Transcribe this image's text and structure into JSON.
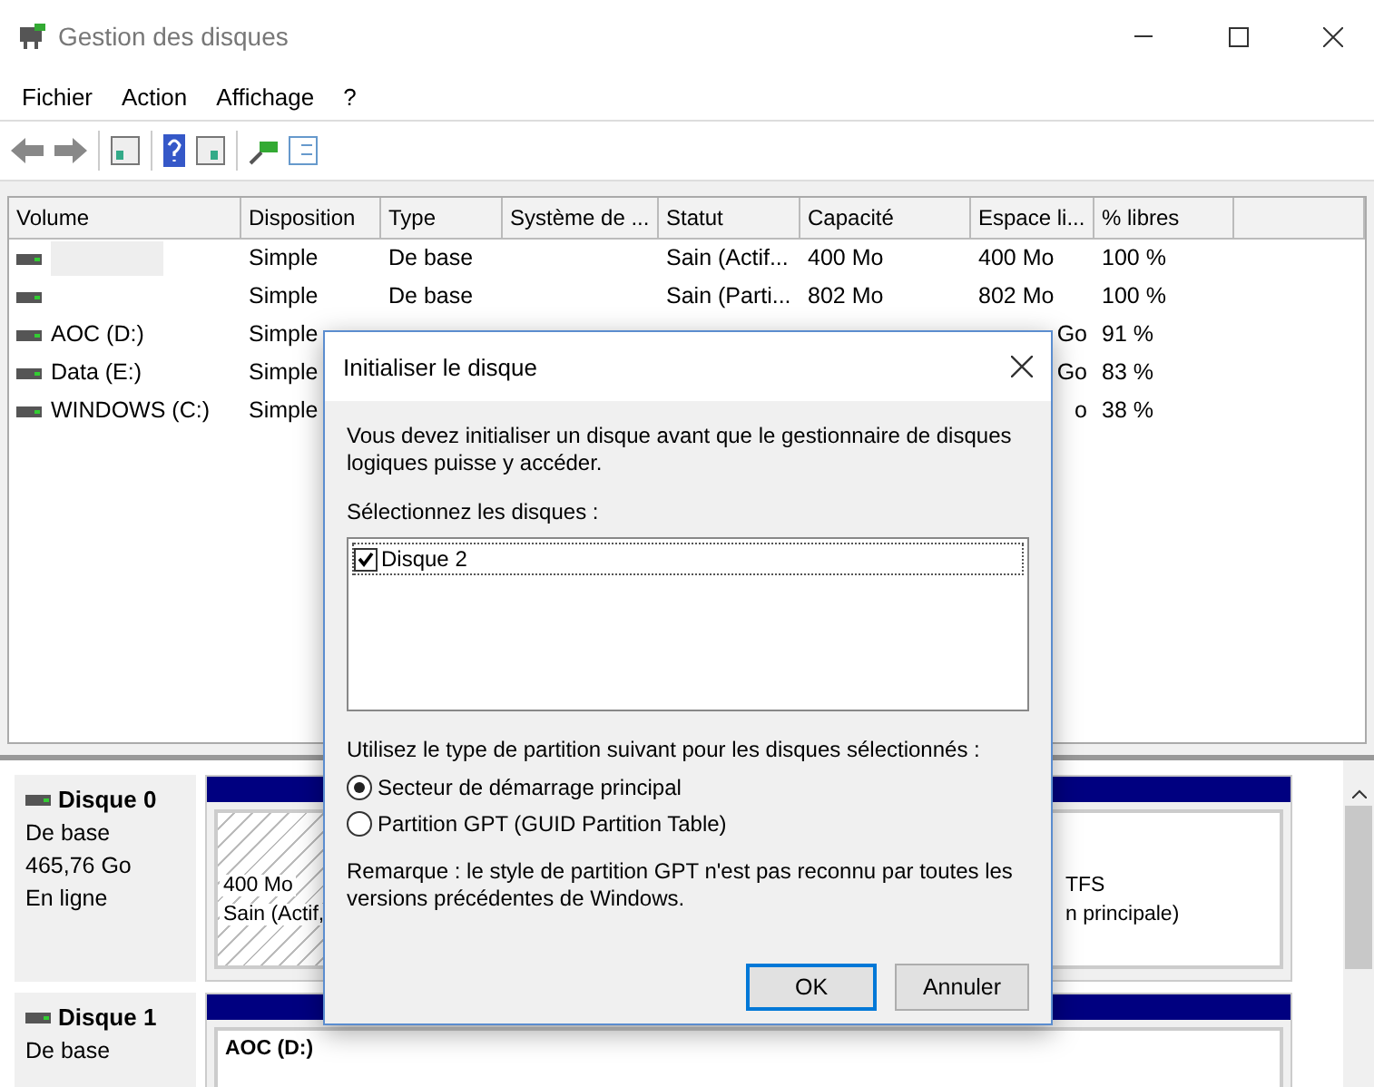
{
  "window": {
    "title": "Gestion des disques"
  },
  "menu": [
    "Fichier",
    "Action",
    "Affichage",
    "?"
  ],
  "table": {
    "columns": [
      "Volume",
      "Disposition",
      "Type",
      "Système de ...",
      "Statut",
      "Capacité",
      "Espace li...",
      "% libres"
    ],
    "rows": [
      {
        "cells": [
          "",
          "Simple",
          "De base",
          "",
          "Sain (Actif...",
          "400 Mo",
          "400 Mo",
          "100 %"
        ],
        "redacted": true
      },
      {
        "cells": [
          "",
          "Simple",
          "De base",
          "",
          "Sain (Parti...",
          "802 Mo",
          "802 Mo",
          "100 %"
        ],
        "redacted": false
      },
      {
        "cells": [
          "AOC (D:)",
          "Simple",
          "",
          "",
          "",
          "",
          "Go",
          "91 %"
        ],
        "redacted": false
      },
      {
        "cells": [
          "Data (E:)",
          "Simple",
          "",
          "",
          "",
          "",
          "Go",
          "83 %"
        ],
        "redacted": false
      },
      {
        "cells": [
          "WINDOWS (C:)",
          "Simple",
          "",
          "",
          "",
          "",
          "o",
          "38 %"
        ],
        "redacted": false
      }
    ]
  },
  "disks": [
    {
      "name": "Disque 0",
      "lines": [
        "De base",
        "465,76 Go",
        "En ligne"
      ],
      "partitions": [
        {
          "kind": "hatched",
          "lines": [
            "400 Mo",
            "Sain (Actif,"
          ]
        },
        {
          "kind": "plain",
          "lines": [
            "TFS",
            "n principale)"
          ]
        }
      ]
    },
    {
      "name": "Disque 1",
      "lines": [
        "De base"
      ],
      "partitions": [
        {
          "kind": "plain-bold",
          "lines": [
            "AOC  (D:)"
          ]
        }
      ]
    }
  ],
  "dialog": {
    "title": "Initialiser le disque",
    "intro": "Vous devez initialiser un disque avant que le gestionnaire de disques logiques puisse y accéder.",
    "select_label": "Sélectionnez les disques :",
    "disks": [
      {
        "label": "Disque 2",
        "checked": true
      }
    ],
    "type_label": "Utilisez le type de partition suivant pour les disques sélectionnés :",
    "options": [
      {
        "label": "Secteur de démarrage principal",
        "selected": true
      },
      {
        "label": "Partition GPT (GUID Partition Table)",
        "selected": false
      }
    ],
    "note": "Remarque : le style de partition GPT n'est pas reconnu par toutes les versions précédentes de Windows.",
    "buttons": [
      {
        "label": "OK",
        "default": true
      },
      {
        "label": "Annuler",
        "default": false
      }
    ]
  }
}
